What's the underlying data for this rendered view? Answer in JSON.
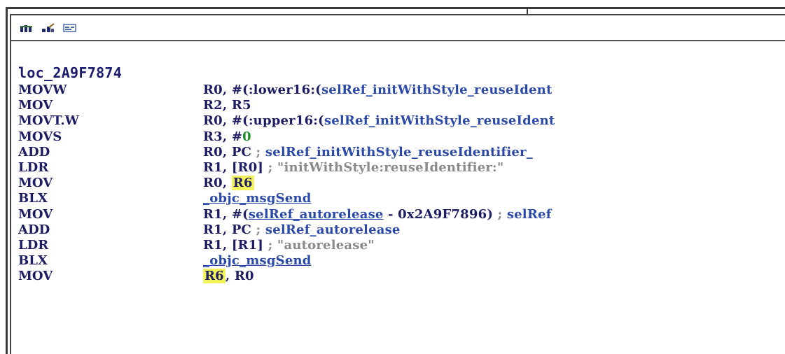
{
  "toolbar": {
    "buttons": [
      {
        "icon": "graph-view-icon"
      },
      {
        "icon": "proximity-view-icon"
      },
      {
        "icon": "text-view-icon"
      }
    ]
  },
  "listing": {
    "label": "loc_2A9F7874",
    "colors": {
      "mnemonic": "#1d1d63",
      "symbol": "#2b4aa8",
      "immediate": "#1f8f2a",
      "comment": "#8a8a8a",
      "highlight": "#f2f25a"
    },
    "rows": [
      {
        "mnemonic": "MOVW",
        "parts": [
          {
            "t": "R0, #(:lower16:(",
            "c": ""
          },
          {
            "t": "selRef_initWithStyle_reuseIdent",
            "c": "sym"
          }
        ]
      },
      {
        "mnemonic": "MOV",
        "parts": [
          {
            "t": "R2, R5",
            "c": ""
          }
        ]
      },
      {
        "mnemonic": "MOVT.W",
        "parts": [
          {
            "t": "R0, #(:upper16:(",
            "c": ""
          },
          {
            "t": "selRef_initWithStyle_reuseIdent",
            "c": "sym"
          }
        ]
      },
      {
        "mnemonic": "MOVS",
        "parts": [
          {
            "t": "R3, #",
            "c": ""
          },
          {
            "t": "0",
            "c": "imm"
          }
        ]
      },
      {
        "mnemonic": "ADD",
        "parts": [
          {
            "t": "R0, PC ",
            "c": ""
          },
          {
            "t": "; ",
            "c": "cmt"
          },
          {
            "t": "selRef_initWithStyle_reuseIdentifier_",
            "c": "sym"
          }
        ]
      },
      {
        "mnemonic": "LDR",
        "parts": [
          {
            "t": "R1, [R0] ",
            "c": ""
          },
          {
            "t": "; \"initWithStyle:reuseIdentifier:\"",
            "c": "cmt"
          }
        ]
      },
      {
        "mnemonic": "MOV",
        "parts": [
          {
            "t": "R0, ",
            "c": ""
          },
          {
            "t": "R6",
            "c": "hl"
          }
        ]
      },
      {
        "mnemonic": "BLX",
        "parts": [
          {
            "t": "_objc_msgSend",
            "c": "sym ul"
          }
        ]
      },
      {
        "mnemonic": "MOV",
        "parts": [
          {
            "t": "R1, #(",
            "c": ""
          },
          {
            "t": "selRef_autorelease",
            "c": "sym ul"
          },
          {
            "t": " - 0x2A9F7896) ",
            "c": ""
          },
          {
            "t": "; ",
            "c": "cmt"
          },
          {
            "t": "selRef",
            "c": "sym"
          }
        ]
      },
      {
        "mnemonic": "ADD",
        "parts": [
          {
            "t": "R1, PC ",
            "c": ""
          },
          {
            "t": "; ",
            "c": "cmt"
          },
          {
            "t": "selRef_autorelease",
            "c": "sym"
          }
        ]
      },
      {
        "mnemonic": "LDR",
        "parts": [
          {
            "t": "R1, [R1] ",
            "c": ""
          },
          {
            "t": "; \"autorelease\"",
            "c": "cmt"
          }
        ]
      },
      {
        "mnemonic": "BLX",
        "parts": [
          {
            "t": "_objc_msgSend",
            "c": "sym ul"
          }
        ]
      },
      {
        "mnemonic": "MOV",
        "parts": [
          {
            "t": "R6",
            "c": "hl"
          },
          {
            "t": ", R0",
            "c": ""
          }
        ]
      }
    ]
  }
}
